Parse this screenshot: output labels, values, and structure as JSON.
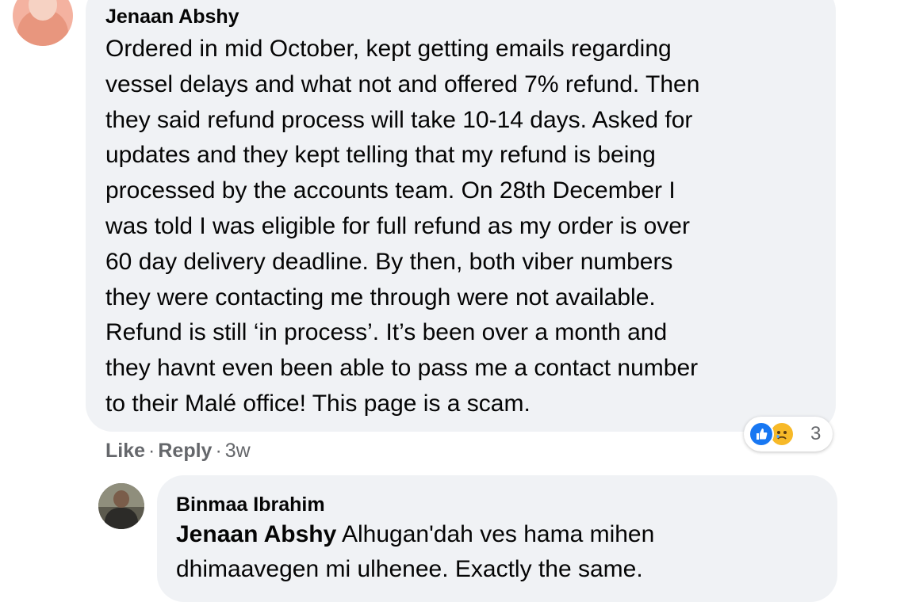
{
  "comment": {
    "author": "Jenaan Abshy",
    "lines": [
      "Ordered in mid October, kept getting emails regarding",
      "vessel delays and what not and offered 7% refund. Then",
      "they said refund process will take 10-14 days. Asked for",
      "updates and they kept telling that my refund is being",
      "processed by the accounts team. On 28th December I",
      "was told I was eligible for full refund as my order is over",
      "60 day delivery deadline. By then, both viber numbers",
      "they were contacting me through were not available.",
      "Refund is still ‘in process’. It’s been over a month and",
      "they havnt even been able to pass me a contact number",
      "to their Malé office! This page is a scam."
    ],
    "reactions": {
      "icons": [
        "like-icon",
        "sad-icon"
      ],
      "count": "3",
      "like_color": "#1877f2",
      "sad_color": "#f7b928"
    },
    "actions": {
      "like": "Like",
      "separator": "·",
      "reply": "Reply",
      "time": "3w"
    }
  },
  "reply": {
    "author": "Binmaa Ibrahim",
    "mention": "Jenaan Abshy",
    "line1_rest": " Alhugan'dah ves hama mihen",
    "line2": "dhimaavegen mi ulhenee. Exactly the same."
  },
  "colors": {
    "bubble_bg": "#f0f2f5",
    "text": "#050505",
    "secondary_text": "#65676b"
  }
}
